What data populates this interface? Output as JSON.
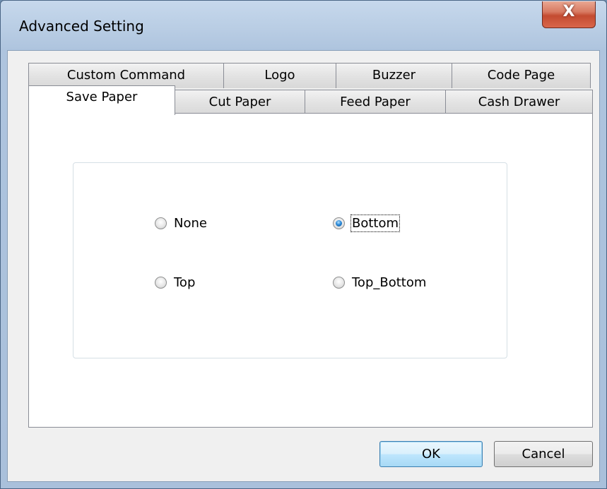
{
  "window": {
    "title": "Advanced Setting",
    "close_symbol": "X"
  },
  "tabs": {
    "row_back": [
      "Custom Command",
      "Logo",
      "Buzzer",
      "Code Page"
    ],
    "row_front": [
      "Save Paper",
      "Cut Paper",
      "Feed Paper",
      "Cash Drawer"
    ],
    "selected": "Save Paper"
  },
  "save_paper": {
    "options": [
      "None",
      "Bottom",
      "Top",
      "Top_Bottom"
    ],
    "selected": "Bottom"
  },
  "buttons": {
    "ok": "OK",
    "cancel": "Cancel"
  },
  "icons": {
    "close": "close-icon",
    "radio": "radio-button-icon"
  },
  "colors": {
    "accent": "#2c8ad8",
    "close_button": "#c34b31"
  }
}
